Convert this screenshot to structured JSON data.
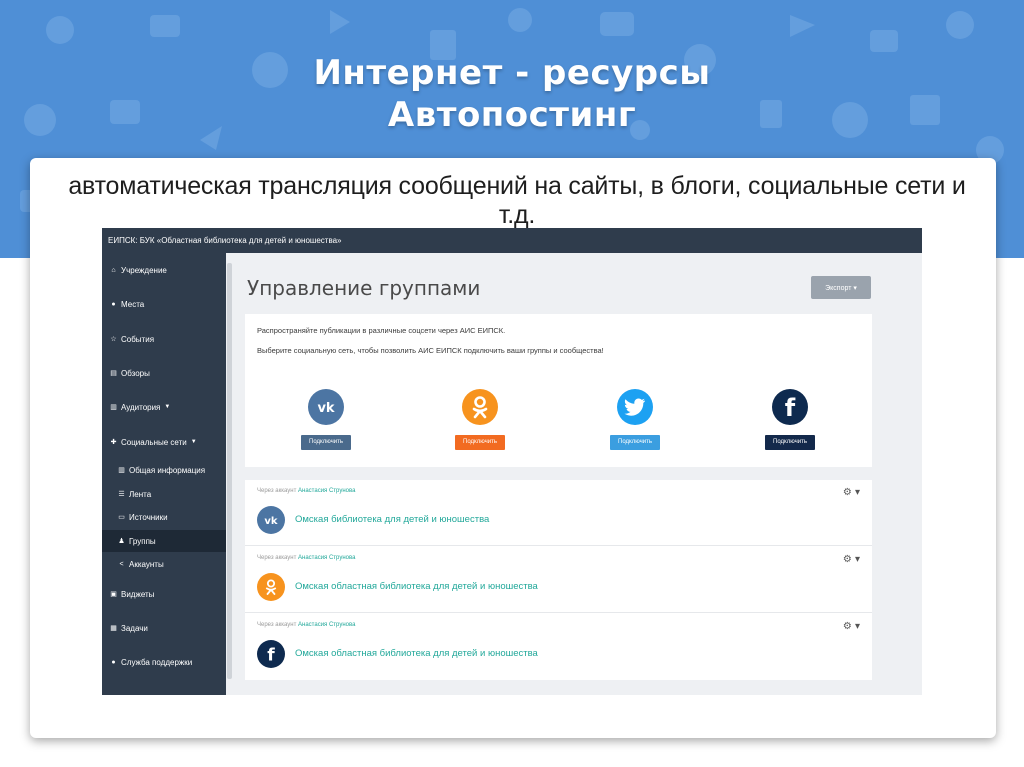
{
  "slide": {
    "title_line1": "Интернет - ресурсы",
    "title_line2": "Автопостинг",
    "subtitle": "автоматическая трансляция сообщений на сайты, в блоги, социальные сети и т.д."
  },
  "app": {
    "topbar_title": "ЕИПСК: БУК «Областная библиотека для детей и юношества»",
    "page_title": "Управление группами",
    "export_label": "Экспорт ▾",
    "sidebar": {
      "items": [
        {
          "icon": "home-icon",
          "glyph": "⌂",
          "label": "Учреждение"
        },
        {
          "icon": "map-marker-icon",
          "glyph": "●",
          "label": "Места"
        },
        {
          "icon": "star-icon",
          "glyph": "☆",
          "label": "События"
        },
        {
          "icon": "list-icon",
          "glyph": "▤",
          "label": "Обзоры"
        },
        {
          "icon": "bar-chart-icon",
          "glyph": "▥",
          "label": "Аудитория"
        },
        {
          "icon": "thumbs-up-icon",
          "glyph": "✚",
          "label": "Социальные сети"
        },
        {
          "icon": "bar-chart-icon",
          "glyph": "▥",
          "label": "Общая информация"
        },
        {
          "icon": "list-icon",
          "glyph": "☰",
          "label": "Лента"
        },
        {
          "icon": "print-icon",
          "glyph": "▭",
          "label": "Источники"
        },
        {
          "icon": "users-icon",
          "glyph": "♟",
          "label": "Группы"
        },
        {
          "icon": "share-icon",
          "glyph": "<",
          "label": "Аккаунты"
        },
        {
          "icon": "image-icon",
          "glyph": "▣",
          "label": "Виджеты"
        },
        {
          "icon": "tasks-icon",
          "glyph": "▦",
          "label": "Задачи"
        },
        {
          "icon": "chat-icon",
          "glyph": "●",
          "label": "Служба поддержки"
        }
      ]
    },
    "info": {
      "line1": "Распространяйте публикации в различные соцсети через АИС ЕИПСК.",
      "line2": "Выберите социальную сеть, чтобы позволить АИС ЕИПСК подключить ваши группы и сообщества!"
    },
    "networks": [
      {
        "name": "vk",
        "icon": "vk-icon",
        "button": "Подключить",
        "color": "#4c75a3",
        "btn_color": "#4a6a8c"
      },
      {
        "name": "ok",
        "icon": "odnoklassniki-icon",
        "button": "Подключить",
        "color": "#f7931e",
        "btn_color": "#f26b21"
      },
      {
        "name": "twitter",
        "icon": "twitter-icon",
        "button": "Подключить",
        "color": "#1da1f2",
        "btn_color": "#3b9ee0"
      },
      {
        "name": "facebook",
        "icon": "facebook-icon",
        "button": "Подключить",
        "color": "#0e2a4f",
        "btn_color": "#13294b"
      }
    ],
    "groups": [
      {
        "via_prefix": "Через аккаунт",
        "account": "Анастасия Струнова",
        "name": "Омская библиотека для детей и юношества",
        "icon": "vk-icon"
      },
      {
        "via_prefix": "Через аккаунт",
        "account": "Анастасия Струнова",
        "name": "Омская областная библиотека для детей и юношества",
        "icon": "odnoklassniki-icon"
      },
      {
        "via_prefix": "Через аккаунт",
        "account": "Анастасия Струнова",
        "name": "Омская областная библиотека для детей и юношества",
        "icon": "facebook-icon"
      }
    ]
  }
}
